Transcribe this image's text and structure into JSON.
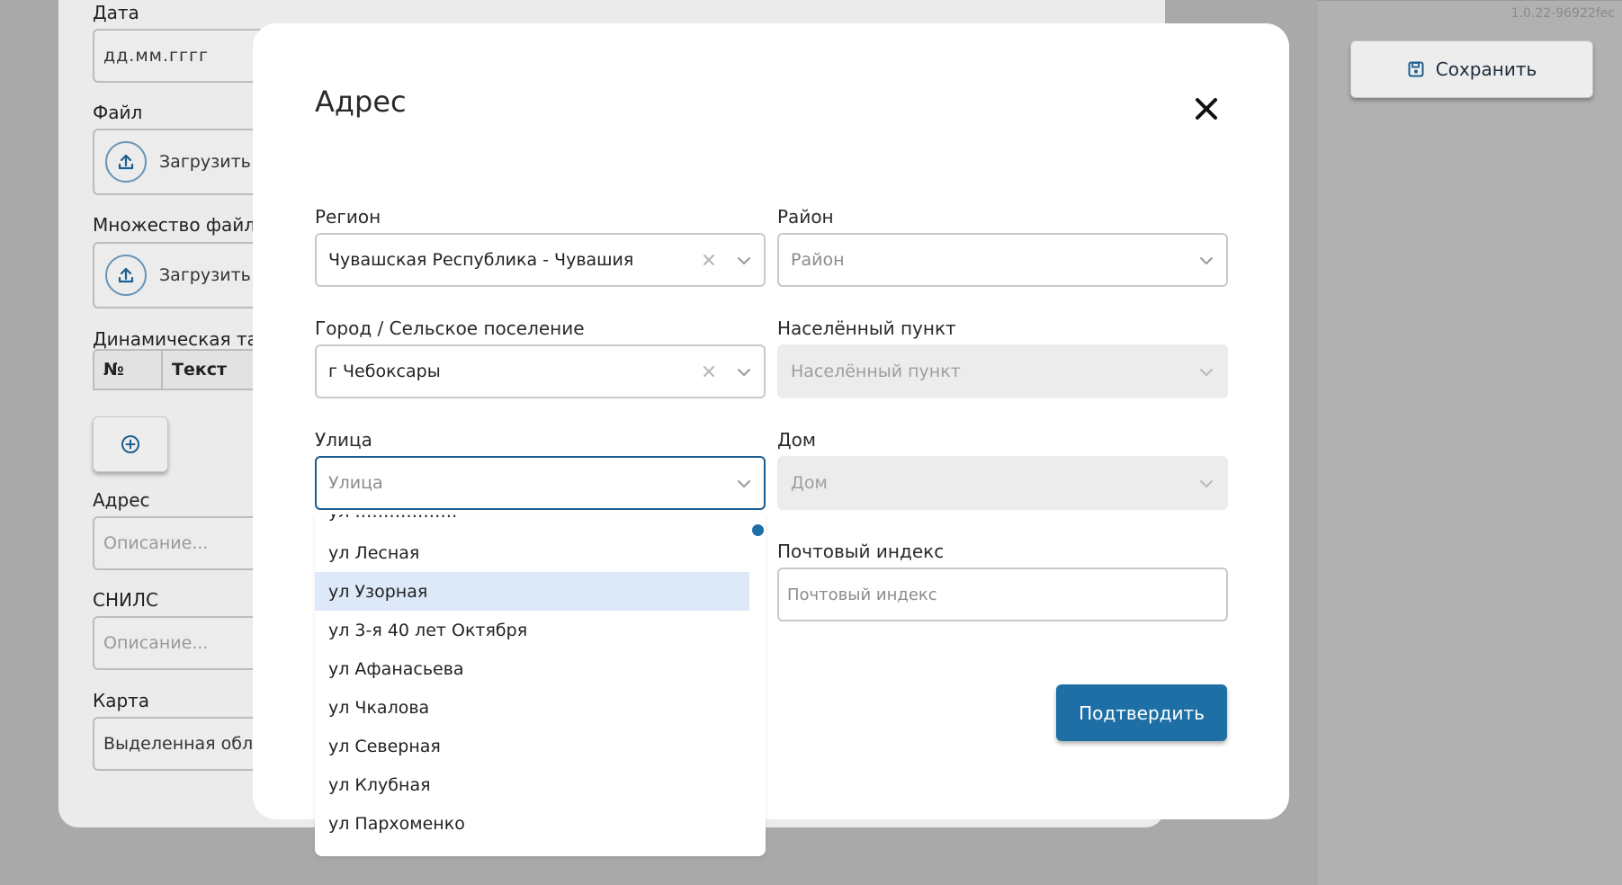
{
  "version": "1.0.22-96922fec",
  "toolbar": {
    "save_label": "Сохранить"
  },
  "background_form": {
    "date_label": "Дата",
    "date_placeholder": "дд.мм.гггг",
    "file_label": "Файл",
    "upload_label": "Загрузить с",
    "multi_file_label": "Множество файлов",
    "multi_upload_label": "Загрузить с",
    "table_label": "Динамическая таб.",
    "table_col1": "№",
    "table_col2": "Текст",
    "address_label": "Адрес",
    "address_placeholder": "Описание...",
    "snils_label": "СНИЛС",
    "snils_placeholder": "Описание...",
    "map_label": "Карта",
    "map_value": "Выделенная област"
  },
  "modal": {
    "title": "Адрес",
    "region": {
      "label": "Регион",
      "value": "Чувашская Республика - Чувашия"
    },
    "district": {
      "label": "Район",
      "placeholder": "Район"
    },
    "city": {
      "label": "Город / Сельское поселение",
      "value": "г Чебоксары"
    },
    "settlement": {
      "label": "Населённый пункт",
      "placeholder": "Населённый пункт"
    },
    "street": {
      "label": "Улица",
      "placeholder": "Улица"
    },
    "house": {
      "label": "Дом",
      "placeholder": "Дом"
    },
    "postal": {
      "label": "Почтовый индекс",
      "placeholder": "Почтовый индекс"
    },
    "confirm_label": "Подтвердить"
  },
  "street_options": [
    "ул Лесная",
    "ул Узорная",
    "ул 3-я 40 лет Октября",
    "ул Афанасьева",
    "ул Чкалова",
    "ул Северная",
    "ул Клубная",
    "ул Пархоменко"
  ],
  "highlighted_option_index": 1,
  "colors": {
    "accent": "#1d6fa6",
    "highlight": "#dde9f9",
    "overlay": "#a9a9a9"
  }
}
